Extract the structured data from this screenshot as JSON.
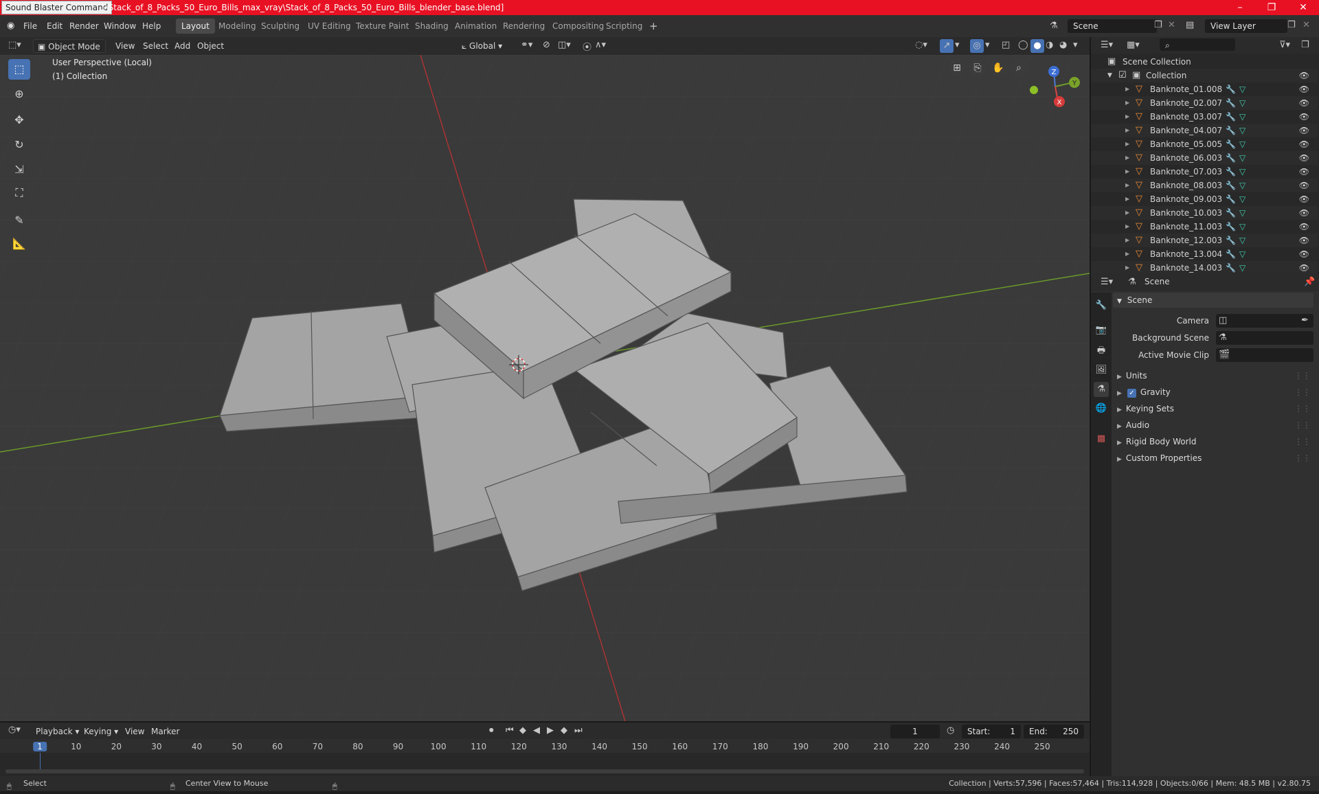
{
  "window": {
    "app_tag": "Sound Blaster Command",
    "title": "1\\Stack_of_8_Packs_50_Euro_Bills_max_vray\\Stack_of_8_Packs_50_Euro_Bills_blender_base.blend]",
    "minimize": "–",
    "maximize": "❐",
    "close": "✕"
  },
  "menu": {
    "file": "File",
    "edit": "Edit",
    "render": "Render",
    "window": "Window",
    "help": "Help"
  },
  "workspaces": [
    "Layout",
    "Modeling",
    "Sculpting",
    "UV Editing",
    "Texture Paint",
    "Shading",
    "Animation",
    "Rendering",
    "Compositing",
    "Scripting"
  ],
  "add_workspace": "+",
  "scene_field": "Scene",
  "view_layer_field": "View Layer",
  "viewport_header": {
    "mode": "Object Mode",
    "view": "View",
    "select": "Select",
    "add": "Add",
    "object": "Object",
    "orientation": "Global"
  },
  "viewport": {
    "perspective": "User Perspective (Local)",
    "collection": "(1) Collection",
    "gizmo": {
      "x": "X",
      "y": "Y",
      "z": "Z"
    }
  },
  "outliner": {
    "root": "Scene Collection",
    "collection": "Collection",
    "items": [
      "Banknote_01.008",
      "Banknote_02.007",
      "Banknote_03.007",
      "Banknote_04.007",
      "Banknote_05.005",
      "Banknote_06.003",
      "Banknote_07.003",
      "Banknote_08.003",
      "Banknote_09.003",
      "Banknote_10.003",
      "Banknote_11.003",
      "Banknote_12.003",
      "Banknote_13.004",
      "Banknote_14.003"
    ]
  },
  "properties": {
    "header": "Scene",
    "section": "Scene",
    "camera_label": "Camera",
    "background_scene_label": "Background Scene",
    "active_movie_clip_label": "Active Movie Clip",
    "panels": [
      "Units",
      "Gravity",
      "Keying Sets",
      "Audio",
      "Rigid Body World",
      "Custom Properties"
    ],
    "gravity_checked": true
  },
  "timeline": {
    "playback": "Playback",
    "keying": "Keying",
    "view": "View",
    "marker": "Marker",
    "current_frame": "1",
    "start_label": "Start:",
    "start": "1",
    "end_label": "End:",
    "end": "250",
    "ruler": [
      "1",
      "10",
      "20",
      "30",
      "40",
      "50",
      "60",
      "70",
      "80",
      "90",
      "100",
      "110",
      "120",
      "130",
      "140",
      "150",
      "160",
      "170",
      "180",
      "190",
      "200",
      "210",
      "220",
      "230",
      "240",
      "250"
    ]
  },
  "statusbar": {
    "select": "Select",
    "center": "Center View to Mouse",
    "stats": "Collection | Verts:57,596 | Faces:57,464 | Tris:114,928 | Objects:0/66 | Mem: 48.5 MB | v2.80.75"
  }
}
